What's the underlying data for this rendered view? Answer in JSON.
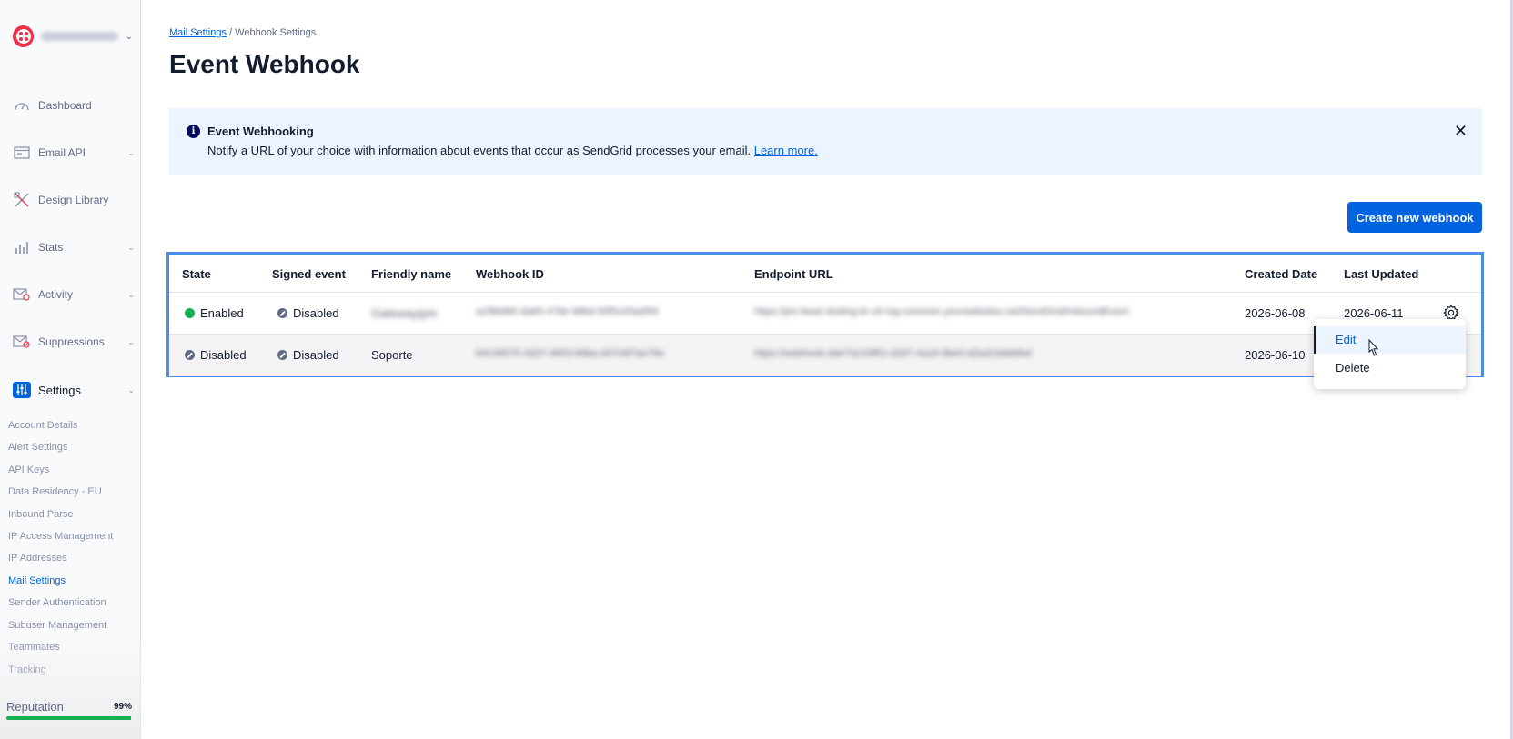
{
  "breadcrumb": {
    "parent": "Mail Settings",
    "separator": "/",
    "current": "Webhook Settings"
  },
  "page_title": "Event Webhook",
  "banner": {
    "title": "Event Webhooking",
    "body": "Notify a URL of your choice with information about events that occur as SendGrid processes your email.",
    "link": "Learn more.",
    "close": "✕"
  },
  "create_button": "Create new webhook",
  "sidebar": {
    "nav": [
      {
        "label": "Dashboard",
        "icon": "gauge-icon"
      },
      {
        "label": "Email API",
        "icon": "envelope-api-icon",
        "chevron": "⌄"
      },
      {
        "label": "Design Library",
        "icon": "design-tools-icon"
      },
      {
        "label": "Stats",
        "icon": "bar-chart-icon",
        "chevron": "⌄"
      },
      {
        "label": "Activity",
        "icon": "envelope-search-icon",
        "chevron": "⌄"
      },
      {
        "label": "Suppressions",
        "icon": "envelope-block-icon",
        "chevron": "⌄"
      },
      {
        "label": "Settings",
        "icon": "sliders-icon",
        "chevron": "⌄"
      }
    ],
    "settings_items": [
      "Account Details",
      "Alert Settings",
      "API Keys",
      "Data Residency - EU",
      "Inbound Parse",
      "IP Access Management",
      "IP Addresses",
      "Mail Settings",
      "Sender Authentication",
      "Subuser Management",
      "Teammates",
      "Tracking"
    ],
    "reputation": {
      "label": "Reputation",
      "value": "99%",
      "fraction": 0.99,
      "color": "#14b053"
    }
  },
  "table": {
    "headers": [
      "State",
      "Signed event",
      "Friendly name",
      "Webhook ID",
      "Endpoint URL",
      "Created Date",
      "Last Updated"
    ],
    "rows": [
      {
        "state": "Enabled",
        "signed": "Disabled",
        "name": "Gateway|pm",
        "webhook_id": "a1f9b680-da65-478e-98bd-93f5c05ad5f4",
        "endpoint": "https://pm-bean-testing-br-cli-reg-common.yourwebsites.net/SendGrid/InboundEvent",
        "created": "2026-06-08",
        "updated": "2026-06-11"
      },
      {
        "state": "Disabled",
        "signed": "Disabled",
        "name": "Soporte",
        "webhook_id": "b4139575-3d37-4853-89ba-d37cbf7ae79e",
        "endpoint": "https://webhook.site/7a133f51-d337-4a18-9be0-d2ad19debfed",
        "created": "2026-06-10",
        "updated": ""
      }
    ]
  },
  "row_menu": {
    "edit": "Edit",
    "delete": "Delete"
  },
  "colors": {
    "primary": "#0263e0",
    "banner_bg": "#ebf4ff",
    "enabled": "#14b053",
    "table_highlight": "#4b8ee8"
  }
}
